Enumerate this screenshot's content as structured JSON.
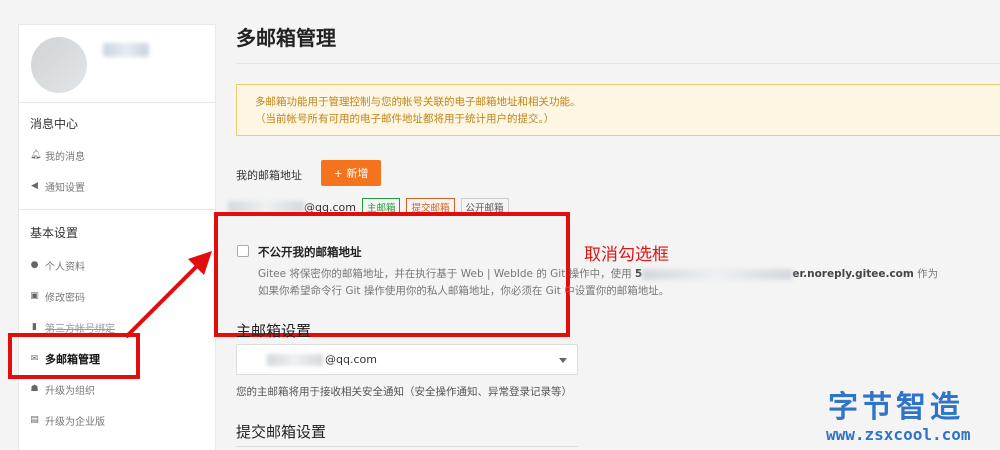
{
  "page": {
    "title": "多邮箱管理"
  },
  "sidebar": {
    "groups": [
      {
        "title": "消息中心",
        "items": [
          {
            "label": "我的消息",
            "icon": "bell-icon"
          },
          {
            "label": "通知设置",
            "icon": "speaker-icon"
          }
        ]
      },
      {
        "title": "基本设置",
        "items": [
          {
            "label": "个人资料",
            "icon": "user-icon"
          },
          {
            "label": "修改密码",
            "icon": "lock-icon"
          },
          {
            "label": "第三方帐号绑定",
            "icon": "bookmark-icon"
          },
          {
            "label": "多邮箱管理",
            "icon": "envelope-icon",
            "active": true
          },
          {
            "label": "升级为组织",
            "icon": "group-icon"
          },
          {
            "label": "升级为企业版",
            "icon": "building-icon"
          }
        ]
      }
    ]
  },
  "notice": {
    "line1": "多邮箱功能用于管理控制与您的帐号关联的电子邮箱地址和相关功能。",
    "line2": "（当前帐号所有可用的电子邮件地址都将用于统计用户的提交。）"
  },
  "emails": {
    "label": "我的邮箱地址",
    "add_label": "+ 新增",
    "address_suffix": "@qq.com",
    "tags": {
      "primary": "主邮箱",
      "submit": "提交邮箱",
      "public": "公开邮箱"
    }
  },
  "privacy": {
    "checkbox_label": "不公开我的邮箱地址",
    "desc_line1_a": "Gitee 将保密你的邮箱地址，并在执行基于 Web | WebIde 的 Git 操作中，使用 ",
    "desc_line1_b": "5",
    "desc_line1_c": "er.noreply.gitee.com",
    "desc_line1_d": " 作为",
    "desc_line2": "如果你希望命令行 Git 操作使用你的私人邮箱地址，你必须在 Git 中设置你的邮箱地址。"
  },
  "annotation": {
    "text": "取消勾选框"
  },
  "primary_email": {
    "title": "主邮箱设置",
    "selected_suffix": "@qq.com",
    "note": "您的主邮箱将用于接收相关安全通知（安全操作通知、异常登录记录等）"
  },
  "submit_email": {
    "title": "提交邮箱设置"
  },
  "watermark": {
    "cn": "字节智造",
    "url": "www.zsxcool.com"
  },
  "colors": {
    "accent": "#f4731c",
    "annotation_red": "#e20e0e",
    "notice_bg": "#fdf6e3",
    "watermark": "#2f74c8"
  }
}
